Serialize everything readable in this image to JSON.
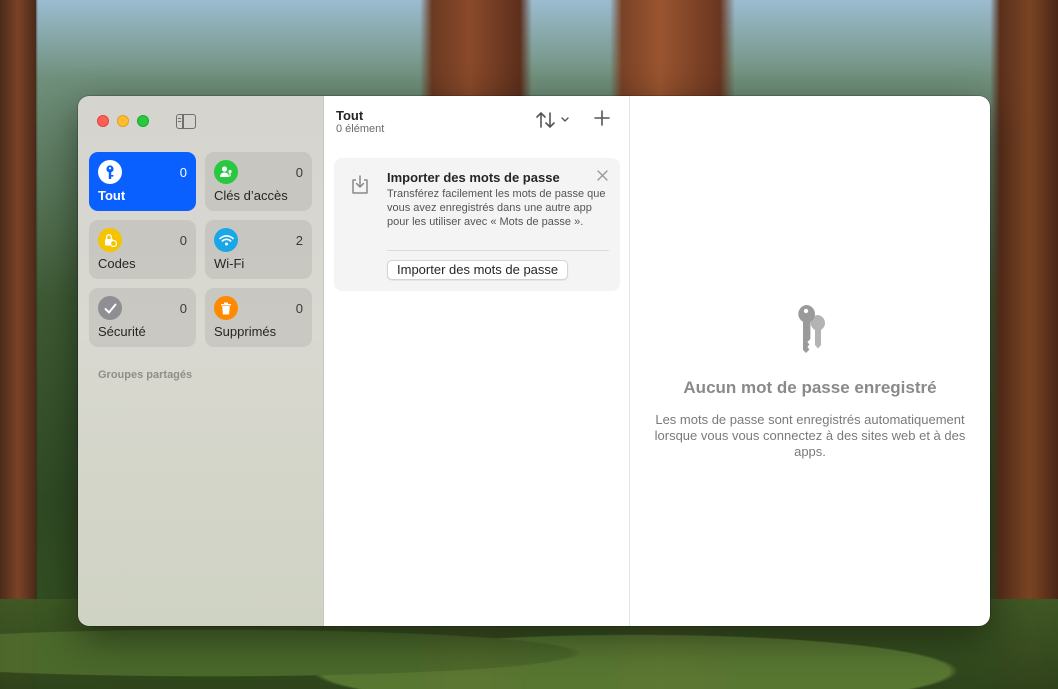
{
  "sidebar": {
    "tiles": [
      {
        "label": "Tout",
        "count": "0",
        "icon": "key-icon",
        "color": "#ffffff",
        "active": true
      },
      {
        "label": "Clés d’accès",
        "count": "0",
        "icon": "person-key-icon",
        "color": "#28c840"
      },
      {
        "label": "Codes",
        "count": "0",
        "icon": "lock-clock-icon",
        "color": "#f5c400"
      },
      {
        "label": "Wi-Fi",
        "count": "2",
        "icon": "wifi-icon",
        "color": "#1aa7e8"
      },
      {
        "label": "Sécurité",
        "count": "0",
        "icon": "checkmark-icon",
        "color": "#8e8e93"
      },
      {
        "label": "Supprimés",
        "count": "0",
        "icon": "trash-icon",
        "color": "#ff8a00"
      }
    ],
    "shared_groups_label": "Groupes partagés"
  },
  "list": {
    "title": "Tout",
    "subtitle": "0 élément",
    "import_card": {
      "title": "Importer des mots de passe",
      "text": "Transférez facilement les mots de passe que vous avez enregistrés dans une autre app pour les utiliser avec « Mots de passe ».",
      "button": "Importer des mots de passe"
    }
  },
  "detail": {
    "empty_title": "Aucun mot de passe enregistré",
    "empty_text": "Les mots de passe sont enregistrés automatiquement lorsque vous vous connectez à des sites web et à des apps."
  },
  "colors": {
    "accent": "#0a60ff"
  }
}
